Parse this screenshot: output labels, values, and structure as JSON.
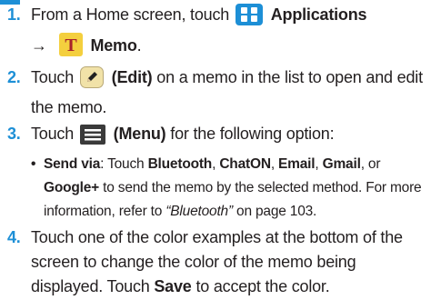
{
  "steps": [
    {
      "num": "1.",
      "text_a": "From a Home screen, touch",
      "applications_label": "Applications",
      "arrow": "→",
      "memo_icon_letter": "T",
      "memo_label": "Memo",
      "period": "."
    },
    {
      "num": "2.",
      "touch": "Touch",
      "edit_label": "(Edit)",
      "rest": "on a memo in the list to open and edit the memo."
    },
    {
      "num": "3.",
      "touch": "Touch",
      "menu_label": "(Menu)",
      "rest": "for the following option:",
      "bullet": {
        "dot": "•",
        "send_via": "Send via",
        "colon_touch": ": Touch",
        "bluetooth": "Bluetooth",
        "chaton": "ChatON",
        "email": "Email",
        "gmail": "Gmail",
        "or": "or",
        "google": "Google+",
        "rest": "to send the memo by the selected method. For more information, refer to",
        "ref": "“Bluetooth”",
        "page": "on page 103."
      }
    },
    {
      "num": "4.",
      "text_a": "Touch one of the color examples at the bottom of the screen to change the color of the memo being displayed. Touch",
      "save": "Save",
      "text_b": "to accept the color."
    }
  ],
  "icons": {
    "applications": "apps-grid-icon",
    "memo": "memo-app-icon",
    "edit": "edit-pencil-icon",
    "menu": "menu-icon"
  },
  "colors": {
    "accent_blue": "#1d8fd6",
    "text": "#231f20",
    "memo_icon_bg": "#f4cf3e",
    "memo_icon_letter": "#a8222a"
  }
}
